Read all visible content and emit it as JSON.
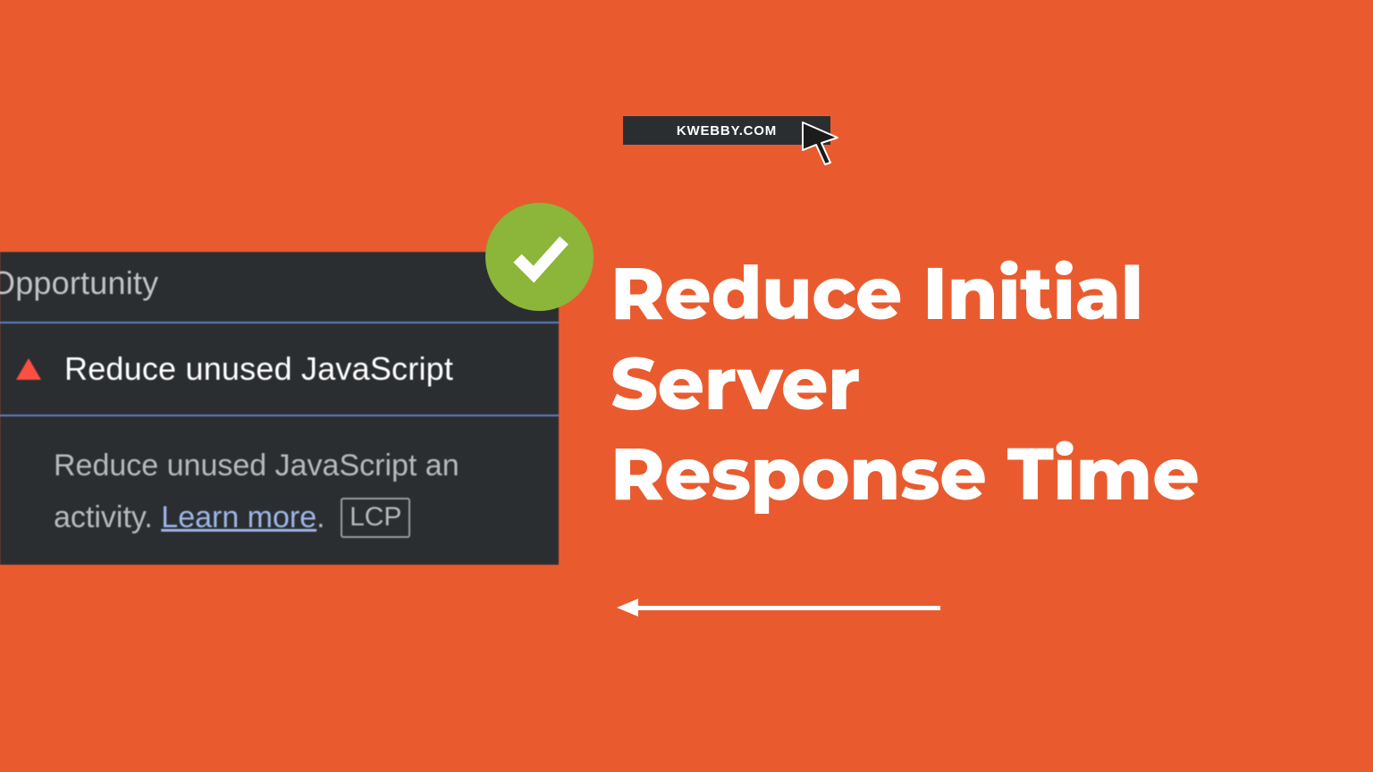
{
  "badge": {
    "label": "KWEBBY.COM"
  },
  "devtools": {
    "section_label": "Opportunity",
    "audit_title": "Reduce unused JavaScript",
    "description_prefix": "Reduce unused JavaScript an",
    "description_line2_prefix": "activity. ",
    "learn_more": "Learn more",
    "description_suffix": ".",
    "lcp_tag": "LCP"
  },
  "headline": {
    "line1": "Reduce Initial",
    "line2": "Server",
    "line3": "Response Time"
  }
}
